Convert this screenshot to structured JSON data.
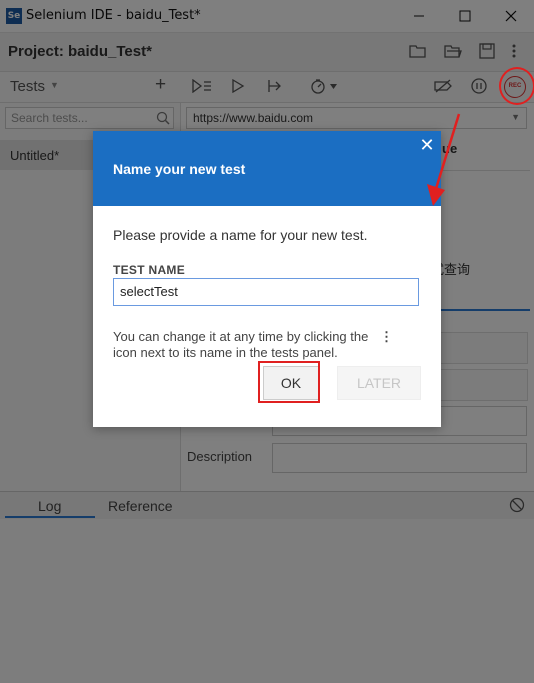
{
  "window": {
    "title": "Selenium IDE - baidu_Test*",
    "app_icon_text": "Se"
  },
  "project": {
    "label": "Project:",
    "name": "baidu_Test*"
  },
  "tests_panel": {
    "title": "Tests",
    "search_placeholder": "Search tests...",
    "selected_test": "Untitled*"
  },
  "url_bar": {
    "value": "https://www.baidu.com"
  },
  "background_fragments": {
    "column_header_fragment": "ue",
    "value_fragment": "式查询",
    "description_label": "Description"
  },
  "bottom_tabs": {
    "log": "Log",
    "reference": "Reference"
  },
  "dialog": {
    "title": "Name your new test",
    "close_symbol": "✕",
    "prompt": "Please provide a name for your new test.",
    "field_label": "TEST NAME",
    "field_value": "selectTest",
    "help_line1": "You can change it at any time by clicking the",
    "help_icon": "⋮",
    "help_line2": "icon next to its name in the tests panel.",
    "ok_label": "OK",
    "later_label": "LATER"
  },
  "rec_label": "REC",
  "colors": {
    "accent_blue": "#1b6ec2",
    "highlight_red": "#e02020"
  }
}
